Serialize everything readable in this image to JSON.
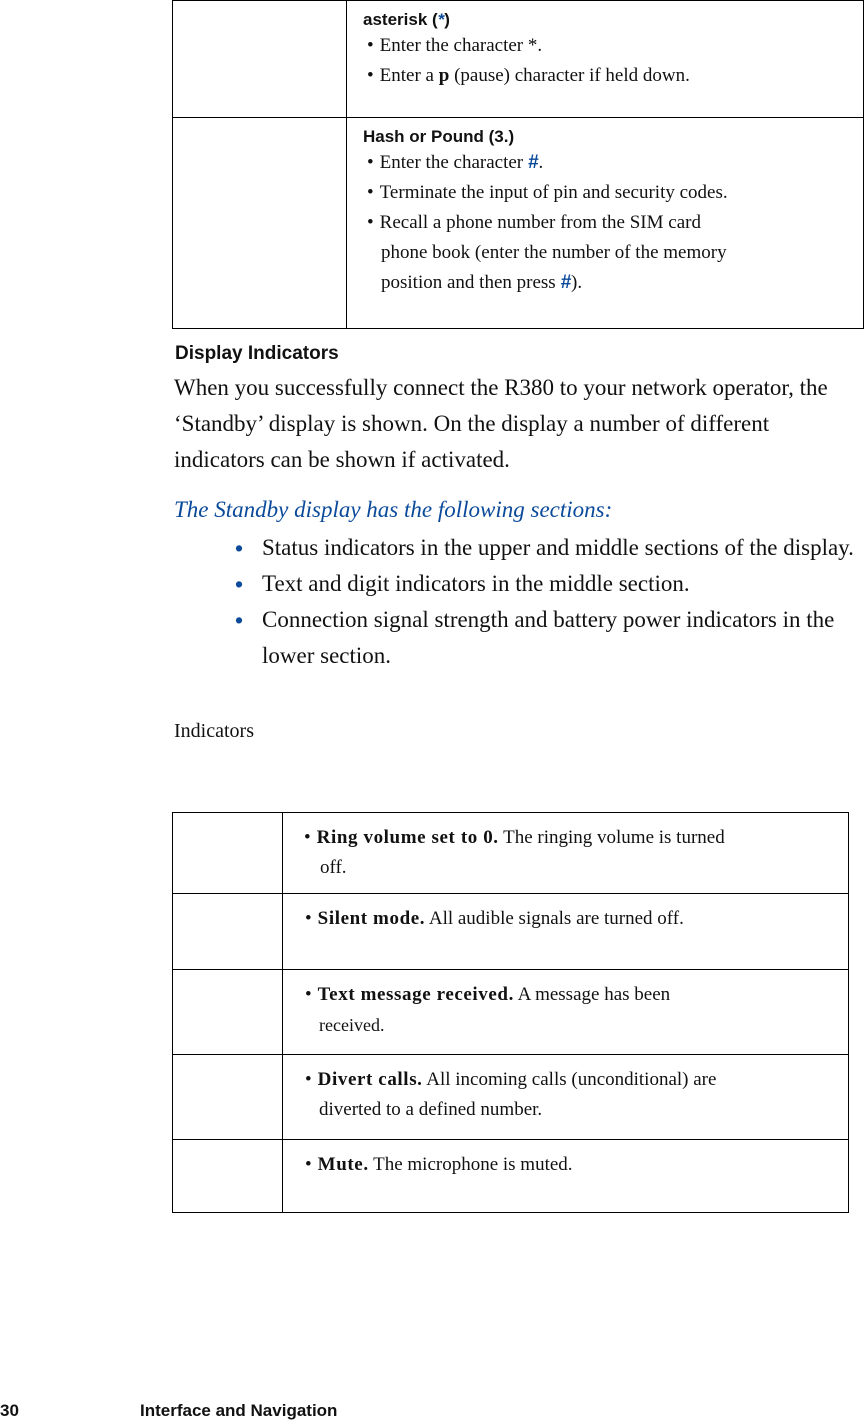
{
  "key_table": {
    "rows": [
      {
        "title_prefix": "asterisk (",
        "title_symbol": "*",
        "title_suffix": ")",
        "bullets": [
          {
            "bullet": "•",
            "text": "Enter the character *."
          },
          {
            "bullet": "•",
            "pre": "Enter a ",
            "bold": "p",
            "post": " (pause) character if held down."
          }
        ]
      },
      {
        "title": "Hash or Pound (3.)",
        "bullets": [
          {
            "bullet": "•",
            "pre": "Enter the character ",
            "symbol": "#",
            "post": "."
          },
          {
            "bullet": "•",
            "text": "Terminate the input of pin and security codes."
          },
          {
            "bullet": "•",
            "text": "Recall a phone number from the SIM card"
          },
          {
            "continuation": "phone book (enter the number of the memory"
          },
          {
            "continuation_pre": "position and then press ",
            "symbol": "#",
            "continuation_post": ")."
          }
        ]
      }
    ]
  },
  "section": {
    "title": "Display Indicators",
    "intro": "When you successfully connect the R380 to your network operator, the ‘Standby’ display is shown. On the display a number of different indicators can be shown if activated.",
    "subhead": "The Standby display has the following sections:",
    "bullets": [
      "Status indicators in the upper and middle sections of the display.",
      "Text and digit indicators in the middle section.",
      "Connection signal strength and battery power indicators in the lower section."
    ],
    "bullet_glyph": "•",
    "indicators_label": "Indicators"
  },
  "indicators": [
    {
      "name": "Ring volume set to 0.",
      "desc": "The ringing volume is turned",
      "desc2": "off."
    },
    {
      "name": "Silent mode.",
      "desc": "All audible signals are turned off.",
      "desc2": ""
    },
    {
      "name": "Text message received.",
      "desc": "A message has been",
      "desc2": "received."
    },
    {
      "name": "Divert calls.",
      "desc": "All incoming calls (unconditional) are",
      "desc2": "diverted to a defined number."
    },
    {
      "name": "Mute.",
      "desc": "The microphone is muted.",
      "desc2": ""
    }
  ],
  "footer": {
    "page_number": "30",
    "chapter": "Interface and Navigation"
  },
  "colors": {
    "accent_blue": "#0b4a9a",
    "text": "#111111",
    "rule": "#000000"
  }
}
